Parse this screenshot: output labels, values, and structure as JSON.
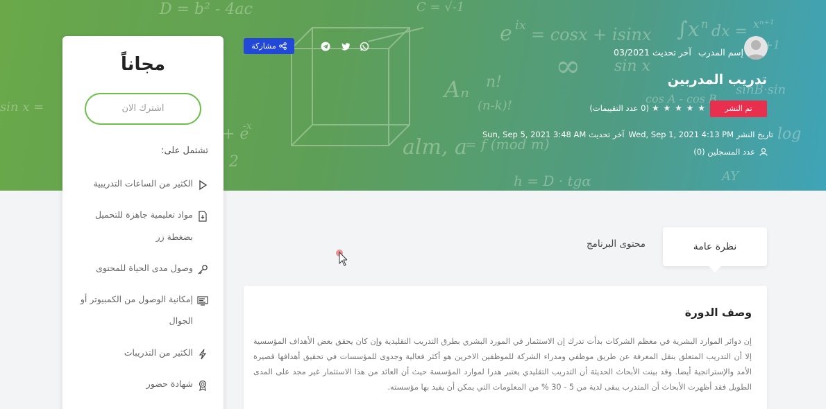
{
  "pricing": {
    "title": "مجاناً",
    "subscribe_label": "اشترك الان",
    "includes_label": "تشتمل على:",
    "features": [
      {
        "icon": "play-icon",
        "label": "الكثير من الساعات التدريبية"
      },
      {
        "icon": "download-file-icon",
        "label": "مواد تعليمية جاهزة للتحميل بضغطة زر"
      },
      {
        "icon": "key-icon",
        "label": "وصول مدى الحياة للمحتوى"
      },
      {
        "icon": "devices-icon",
        "label": "إمكانية الوصول من الكمبيوتر أو الجوال"
      },
      {
        "icon": "lightning-icon",
        "label": "الكثير من التدريبات"
      },
      {
        "icon": "certificate-icon",
        "label": "شهادة حضور"
      }
    ]
  },
  "course": {
    "trainer_name": "إسم المدرب",
    "last_update_label": "آخر تحديث 03/2021",
    "title": "تدريب المدربين",
    "status": "تم النشر",
    "rating_text": "(0 عدد التقييمات)",
    "stars": "★ ★ ★ ★ ★",
    "publish_date": "تاريخ النشر Wed, Sep 1, 2021 4:13 PM",
    "updated_date": "آخر تحديث Sun, Sep 5, 2021 3:48 AM",
    "registered": "عدد المسجلين (0)"
  },
  "share": {
    "label": "مشاركة"
  },
  "social": [
    "whatsapp-icon",
    "twitter-icon",
    "telegram-icon"
  ],
  "tabs": {
    "overview": "نظرة عامة",
    "content": "محتوى البرنامج"
  },
  "description": {
    "title": "وصف الدورة",
    "text": "إن دوائر الموارد البشرية في معظم الشركات بدأت تدرك إن الاستثمار في المورد البشري بطرق التدريب التقليدية وإن كان يحقق بعض الأهداف المؤسسية إلا أن التدريب المتعلق بنقل المعرفة عن طريق موظفي ومدراء الشركة للموظفين الاخرين هو أكثر فعالية وجدوى للمؤسسات في تحقيق أهدافها قصيرة الأمد والإستراتجية أيضا. وقد بينت الأبحاث الحديثة أن التدريب التقليدي يعتبر هدرا لموارد المؤسسة حيث أن العائد من هذا الاستثمار غير مجد على المدى الطويل فقد أظهرت الأبحاث أن المتدرب يبقى لدية من 5 - 30 % من المعلومات التي يمكن أن يفيد بها مؤسسته."
  },
  "colors": {
    "accent_green": "#6cc04a",
    "status_red": "#e8304e",
    "share_blue": "#2248d8"
  }
}
